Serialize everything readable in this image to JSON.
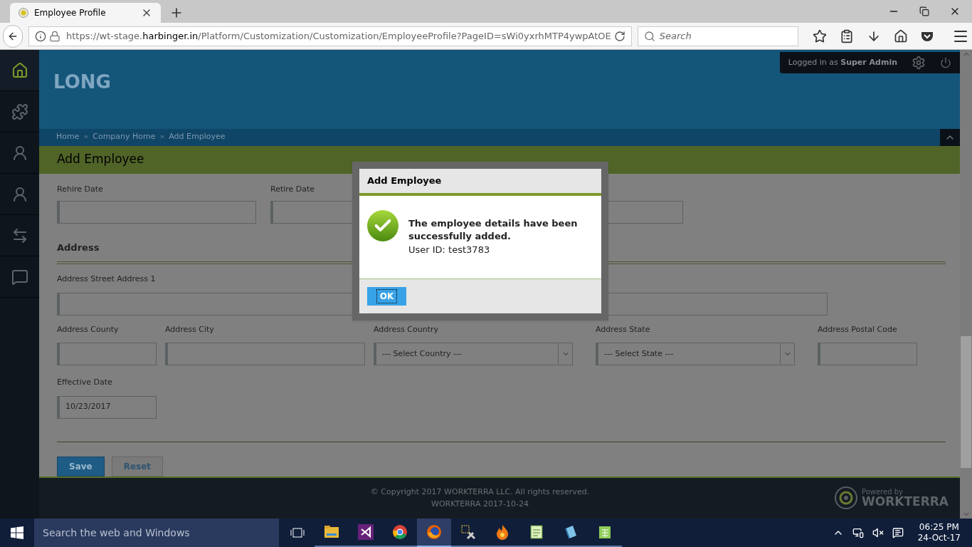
{
  "browser": {
    "tab_title": "Employee Profile",
    "url": {
      "prefix": "https://wt-stage.",
      "host": "harbinger.in",
      "path": "/Platform/Customization/Customization/EmployeeProfile?PageID=sWi0yxrhMTP4ywpAtOE"
    },
    "search": {
      "placeholder": "Search"
    }
  },
  "sidebar": {
    "items": [
      {
        "kind": "home",
        "selected": true
      },
      {
        "kind": "puzzle",
        "selected": false
      },
      {
        "kind": "user-star",
        "selected": false
      },
      {
        "kind": "user",
        "selected": false
      },
      {
        "kind": "arrows",
        "selected": false
      },
      {
        "kind": "chat",
        "selected": false
      }
    ]
  },
  "header": {
    "brand": "LONG",
    "logged_in_label": "Logged in as",
    "user": "Super Admin"
  },
  "breadcrumbs": {
    "separator": "»",
    "items": [
      "Home",
      "Company Home",
      "Add Employee"
    ]
  },
  "page_title": "Add Employee",
  "form": {
    "row_1": [
      {
        "kind": "labeled",
        "label": "Rehire Date"
      },
      {
        "kind": "labeled",
        "label": "Retire Date"
      },
      {
        "kind": "unlabeled"
      }
    ],
    "section": "Address",
    "street": {
      "label": "Address Street Address 1"
    },
    "row_2": [
      {
        "kind": "text",
        "label": "Address County"
      },
      {
        "kind": "text",
        "label": "Address City"
      },
      {
        "kind": "select",
        "label": "Address Country",
        "value": "--- Select Country ---"
      },
      {
        "kind": "select",
        "label": "Address State",
        "value": "--- Select State ---"
      },
      {
        "kind": "text",
        "label": "Address Postal Code"
      }
    ],
    "effective_date": {
      "label": "Effective Date",
      "value": "10/23/2017"
    },
    "buttons": [
      {
        "kind": "primary",
        "label": "Save"
      },
      {
        "kind": "secondary",
        "label": "Reset"
      }
    ]
  },
  "dialog": {
    "title": "Add Employee",
    "message": "The employee details have been successfully added.",
    "detail": "User ID: test3783",
    "button": "OK"
  },
  "footer": {
    "copyright": "© Copyright 2017 WORKTERRA LLC. All rights reserved.",
    "version": "WORKTERRA 2017-10-24",
    "powered_by": "Powered by",
    "brand": "WORKTERRA"
  },
  "taskbar": {
    "search": {
      "placeholder": "Search the web and Windows"
    },
    "apps": [
      {
        "kind": "folder",
        "selected": false
      },
      {
        "kind": "vs",
        "selected": false
      },
      {
        "kind": "chrome",
        "selected": false
      },
      {
        "kind": "firefox",
        "selected": true
      },
      {
        "kind": "tools",
        "selected": false
      },
      {
        "kind": "flame",
        "selected": false
      },
      {
        "kind": "notepad",
        "selected": false
      },
      {
        "kind": "book",
        "selected": false
      },
      {
        "kind": "sheet",
        "selected": false
      }
    ],
    "time": "06:25 PM",
    "date": "24-Oct-17"
  }
}
